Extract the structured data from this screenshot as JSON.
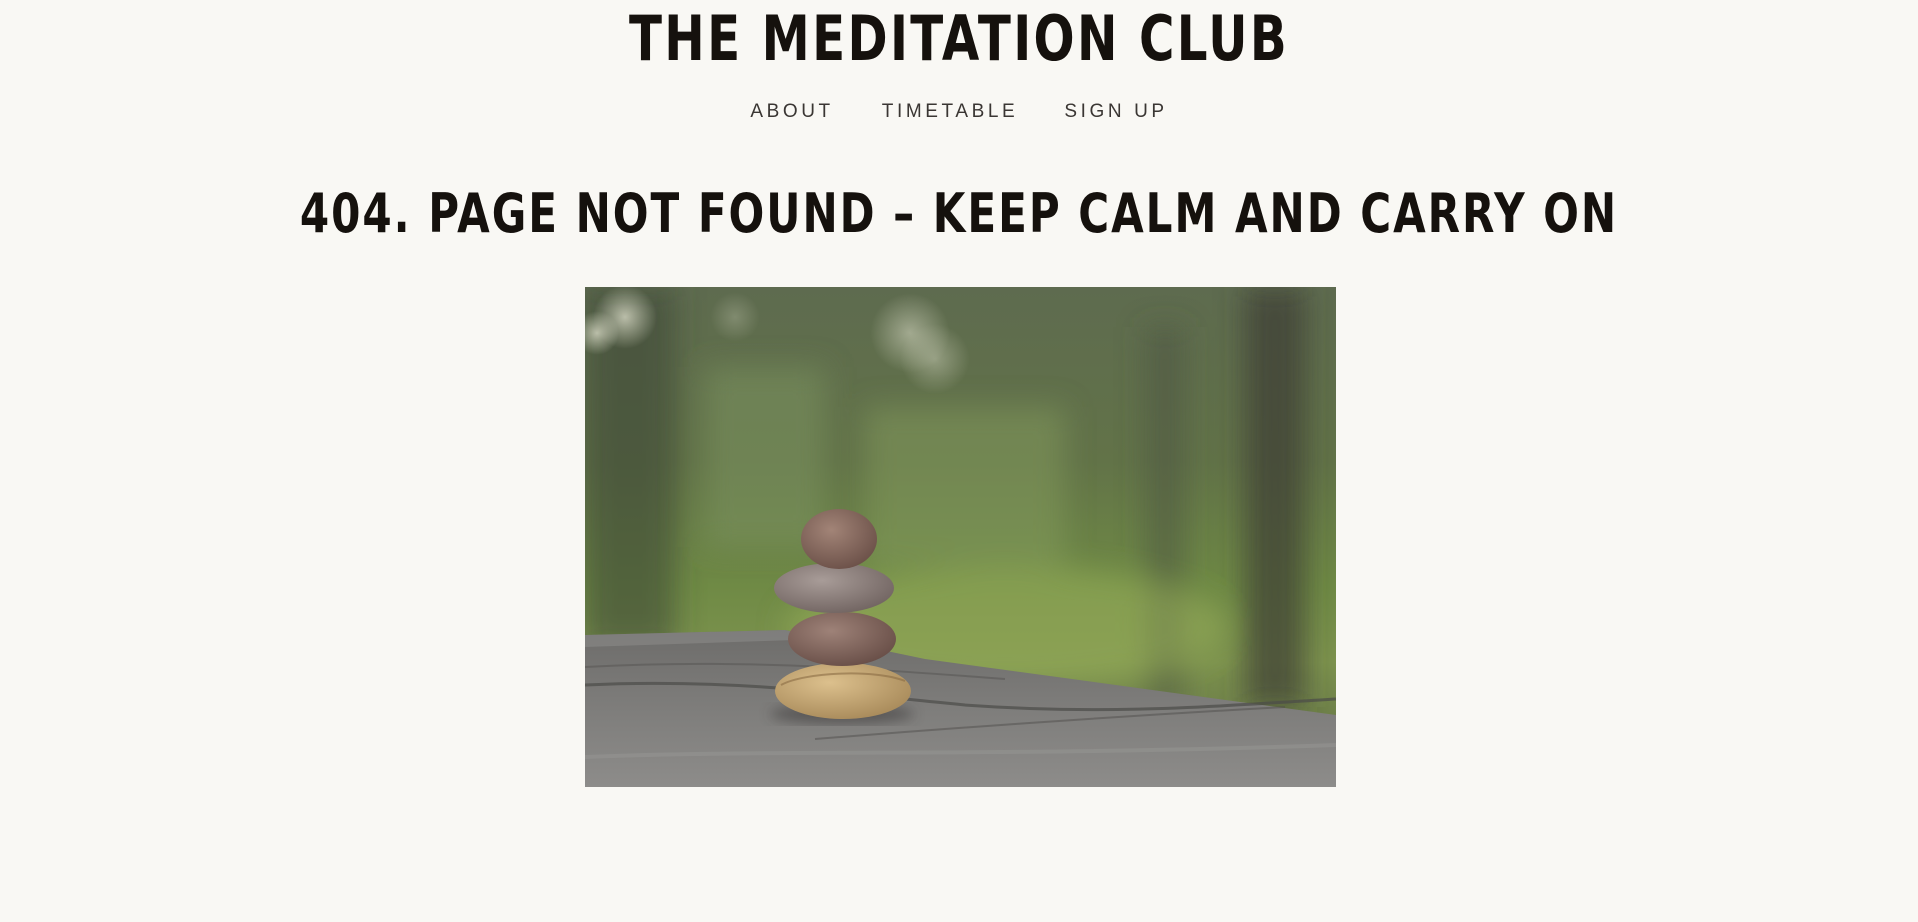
{
  "site": {
    "title": "THE MEDITATION CLUB"
  },
  "nav": {
    "items": [
      {
        "label": "ABOUT"
      },
      {
        "label": "TIMETABLE"
      },
      {
        "label": "SIGN UP"
      }
    ]
  },
  "main": {
    "heading": "404. PAGE NOT FOUND – KEEP CALM AND CARRY ON",
    "image": {
      "alt": "stacked-pebbles-photo"
    }
  },
  "colors": {
    "background": "#f9f8f4",
    "text": "#15110d",
    "nav_text": "#3a3633"
  }
}
